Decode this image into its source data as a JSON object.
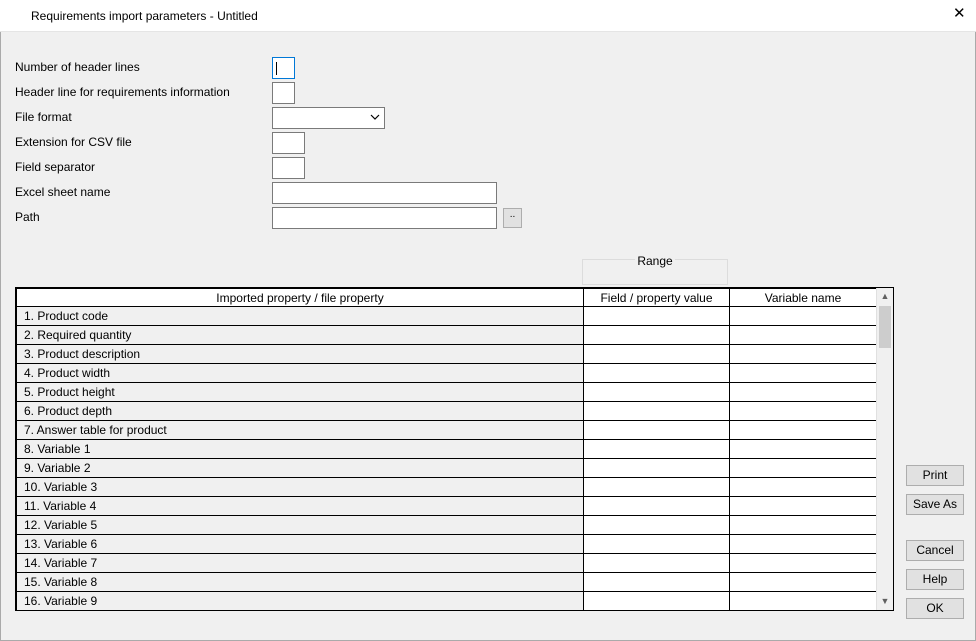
{
  "window": {
    "title": "Requirements import parameters - Untitled",
    "close_glyph": "✕"
  },
  "form": {
    "header_lines_label": "Number of header lines",
    "header_line_info_label": "Header line for requirements information",
    "file_format_label": "File format",
    "csv_extension_label": "Extension for CSV file",
    "field_separator_label": "Field separator",
    "excel_sheet_label": "Excel sheet name",
    "path_label": "Path",
    "header_lines_value": "",
    "header_line_info_value": "",
    "file_format_value": "",
    "csv_extension_value": "",
    "field_separator_value": "",
    "excel_sheet_value": "",
    "path_value": "",
    "browse_label": ".."
  },
  "table": {
    "range_label": "Range",
    "columns": [
      "Imported property / file property",
      "Field / property value",
      "Variable name"
    ],
    "rows": [
      {
        "label": "1. Product code"
      },
      {
        "label": "2. Required quantity"
      },
      {
        "label": "3. Product description"
      },
      {
        "label": "4. Product width"
      },
      {
        "label": "5. Product height"
      },
      {
        "label": "6. Product depth"
      },
      {
        "label": "7. Answer table for product"
      },
      {
        "label": "8. Variable 1"
      },
      {
        "label": "9. Variable 2"
      },
      {
        "label": "10. Variable 3"
      },
      {
        "label": "11. Variable 4"
      },
      {
        "label": "12. Variable 5"
      },
      {
        "label": "13. Variable 6"
      },
      {
        "label": "14. Variable 7"
      },
      {
        "label": "15. Variable 8"
      },
      {
        "label": "16. Variable 9"
      },
      {
        "label": ""
      }
    ]
  },
  "buttons": {
    "print": "Print",
    "save_as": "Save As",
    "cancel": "Cancel",
    "help": "Help",
    "ok": "OK"
  },
  "colors": {
    "window_bg": "#f0f0f0",
    "focus_border": "#0078d7",
    "button_bg": "#e1e1e1"
  }
}
